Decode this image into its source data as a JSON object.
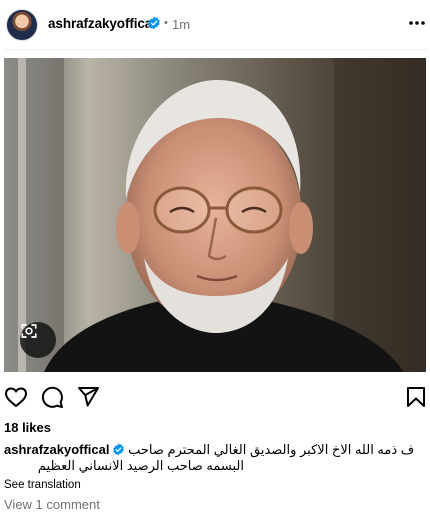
{
  "post": {
    "username": "ashrafzakyoffical",
    "dot": "•",
    "time": "1m",
    "likes": "18 likes",
    "caption_user": "ashrafzakyoffical",
    "caption_line1": "ف ذمه الله الاخ الاكبر والصديق الغالي المحترم صاحب",
    "caption_line2": "البسمه صاحب الرصيد الانساني العظيم",
    "see_translation": "See translation",
    "view_comments": "View 1 comment"
  },
  "icons": {
    "verified": "verified-badge-icon",
    "more": "more-options-icon",
    "like": "heart-icon",
    "comment": "comment-icon",
    "share": "send-icon",
    "save": "bookmark-icon",
    "camera": "lens-icon"
  },
  "colors": {
    "verified_blue": "#0095f6",
    "muted": "#737373"
  }
}
